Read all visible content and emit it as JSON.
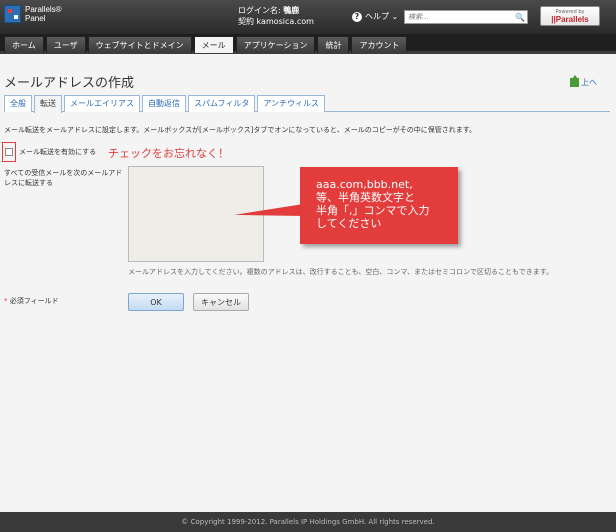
{
  "header": {
    "logo_line1": "Parallels®",
    "logo_line2": "Panel",
    "login_label": "ログイン名: ",
    "login_name": "鴨鹿",
    "contract_label": "契約 ",
    "contract_domain": "kamosica.com",
    "help_label": "ヘルプ ⌄",
    "search_placeholder": "検索...",
    "powered_by": "Powered by",
    "powered_brand": "||Parallels"
  },
  "nav": {
    "tabs": [
      {
        "label": "ホーム",
        "active": false
      },
      {
        "label": "ユーザ",
        "active": false
      },
      {
        "label": "ウェブサイトとドメイン",
        "active": false
      },
      {
        "label": "メール",
        "active": true
      },
      {
        "label": "アプリケーション",
        "active": false
      },
      {
        "label": "統計",
        "active": false
      },
      {
        "label": "アカウント",
        "active": false
      }
    ]
  },
  "page": {
    "title": "メールアドレスの作成",
    "up_label": "上へ",
    "tabs": [
      {
        "label": "全般",
        "active": false
      },
      {
        "label": "転送",
        "active": true
      },
      {
        "label": "メールエイリアス",
        "active": false
      },
      {
        "label": "自動返信",
        "active": false
      },
      {
        "label": "スパムフィルタ",
        "active": false
      },
      {
        "label": "アンチウィルス",
        "active": false
      }
    ],
    "description": "メール転送をメールアドレスに設定します。メールボックスが[メールボックス]タブでオンになっていると、メールのコピーがその中に保管されます。",
    "enable_label": "メール転送を有効にする",
    "reminder": "チェックをお忘れなく！",
    "forward_label": "すべての受信メールを次のメールアドレスに転送する",
    "hint": "メールアドレスを入力してください。複数のアドレスは、改行することも、空白、コンマ、またはセミコロンで区切ることもできます。",
    "callout": [
      "aaa.com,bbb.net,",
      "等、半角英数文字と",
      "半角「,」コンマで入力",
      "してください"
    ],
    "required_star": "*",
    "required_label": " 必須フィールド",
    "ok_label": "OK",
    "cancel_label": "キャンセル"
  },
  "footer": {
    "copyright": "© Copyright 1999-2012. Parallels IP Holdings GmbH. All rights reserved."
  },
  "colors": {
    "accent_red": "#e23c3c",
    "link_blue": "#2a6ab5",
    "header_dark": "#2b2b2b"
  }
}
